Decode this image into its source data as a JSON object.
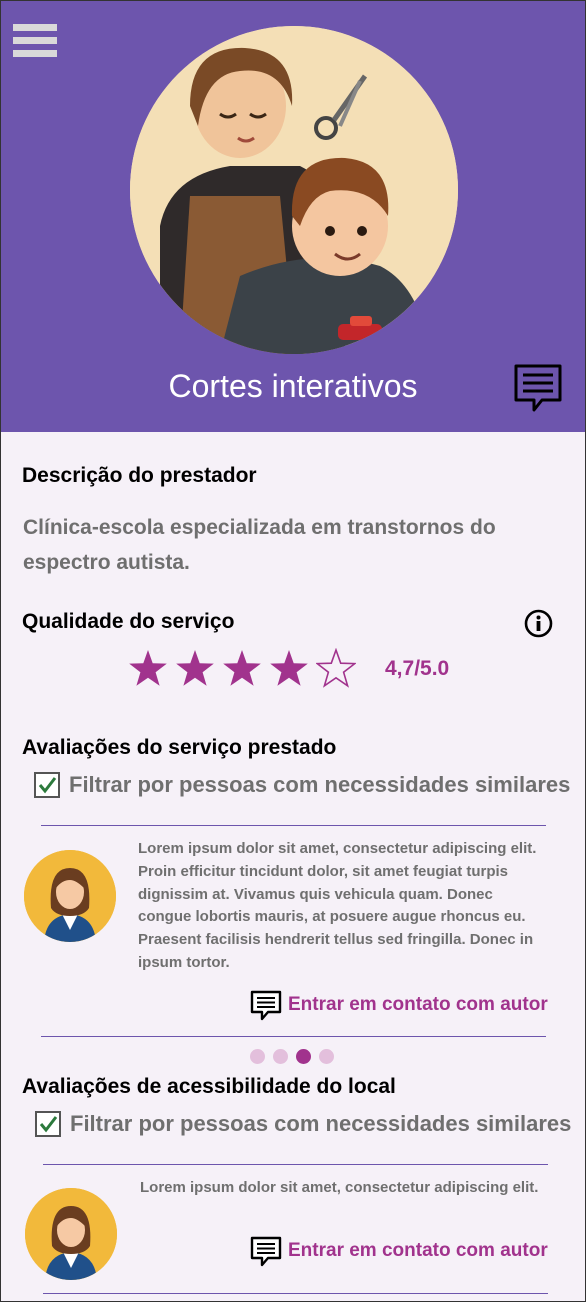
{
  "header": {
    "title": "Cortes interativos",
    "bg_color": "#6d55ad",
    "menu_icon": "hamburger-icon",
    "chat_icon": "chat-icon"
  },
  "provider": {
    "section_title": "Descrição do prestador",
    "description": "Clínica-escola especializada em transtornos do espectro autista."
  },
  "quality": {
    "section_title": "Qualidade do serviço",
    "info_icon": "info-icon",
    "stars_filled": 4,
    "stars_total": 5,
    "rating_text": "4,7/5.0",
    "accent_color": "#a1338d"
  },
  "service_reviews": {
    "section_title": "Avaliações do serviço prestado",
    "filter_label": "Filtrar por pessoas com necessidades similares",
    "filter_checked": true,
    "review_text": "Lorem ipsum dolor sit amet, consectetur adipiscing elit. Proin efficitur tincidunt dolor, sit amet feugiat turpis dignissim at. Vivamus quis  vehicula quam. Donec congue lobortis mauris, at posuere augue rhoncus  eu. Praesent facilisis hendrerit tellus sed fringilla. Donec in ipsum  tortor.",
    "contact_label": "Entrar em contato com autor",
    "pagination": {
      "total": 4,
      "active_index": 2
    }
  },
  "accessibility_reviews": {
    "section_title": "Avaliações de acessibilidade do local",
    "filter_label": "Filtrar por pessoas com necessidades similares",
    "filter_checked": true,
    "review_text": "Lorem ipsum dolor sit amet, consectetur adipiscing elit.",
    "contact_label": "Entrar em contato com autor"
  }
}
